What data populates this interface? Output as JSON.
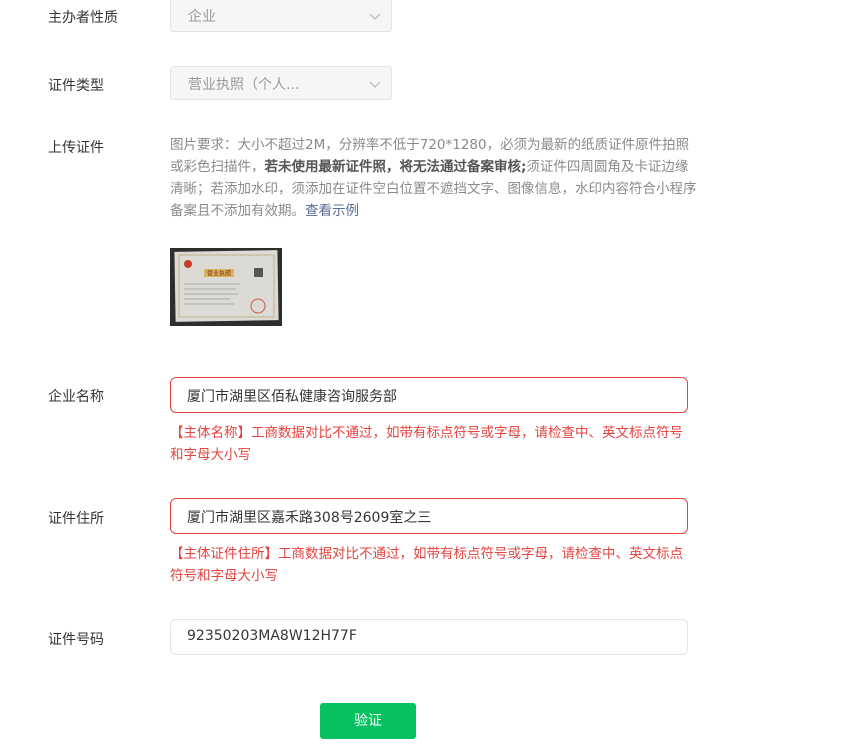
{
  "form": {
    "host_type": {
      "label": "主办者性质",
      "value": "企业"
    },
    "cert_type": {
      "label": "证件类型",
      "value": "营业执照（个人..."
    },
    "upload": {
      "label": "上传证件",
      "desc_a": "图片要求：大小不超过2M，分辨率不低于720*1280，必须为最新的纸质证件原件拍照或彩色扫描件，",
      "desc_b": "若未使用最新证件照，将无法通过备案审核;",
      "desc_c": "须证件四周圆角及卡证边缘清晰；若添加水印，须添加在证件空白位置不遮挡文字、图像信息，水印内容符合小程序备案且不添加有效期。",
      "example_link": "查看示例",
      "thumbnail_title": "营业执照"
    },
    "company_name": {
      "label": "企业名称",
      "value": "厦门市湖里区佰私健康咨询服务部",
      "error": "【主体名称】工商数据对比不通过，如带有标点符号或字母，请检查中、英文标点符号和字母大小写"
    },
    "address": {
      "label": "证件住所",
      "value": "厦门市湖里区嘉禾路308号2609室之三",
      "error": "【主体证件住所】工商数据对比不通过，如带有标点符号或字母，请检查中、英文标点符号和字母大小写"
    },
    "cert_number": {
      "label": "证件号码",
      "value": "92350203MA8W12H77F"
    },
    "verify_button": "验证"
  },
  "colors": {
    "primary_green": "#07c160",
    "error_red": "#e64340",
    "link_blue": "#576b95"
  }
}
